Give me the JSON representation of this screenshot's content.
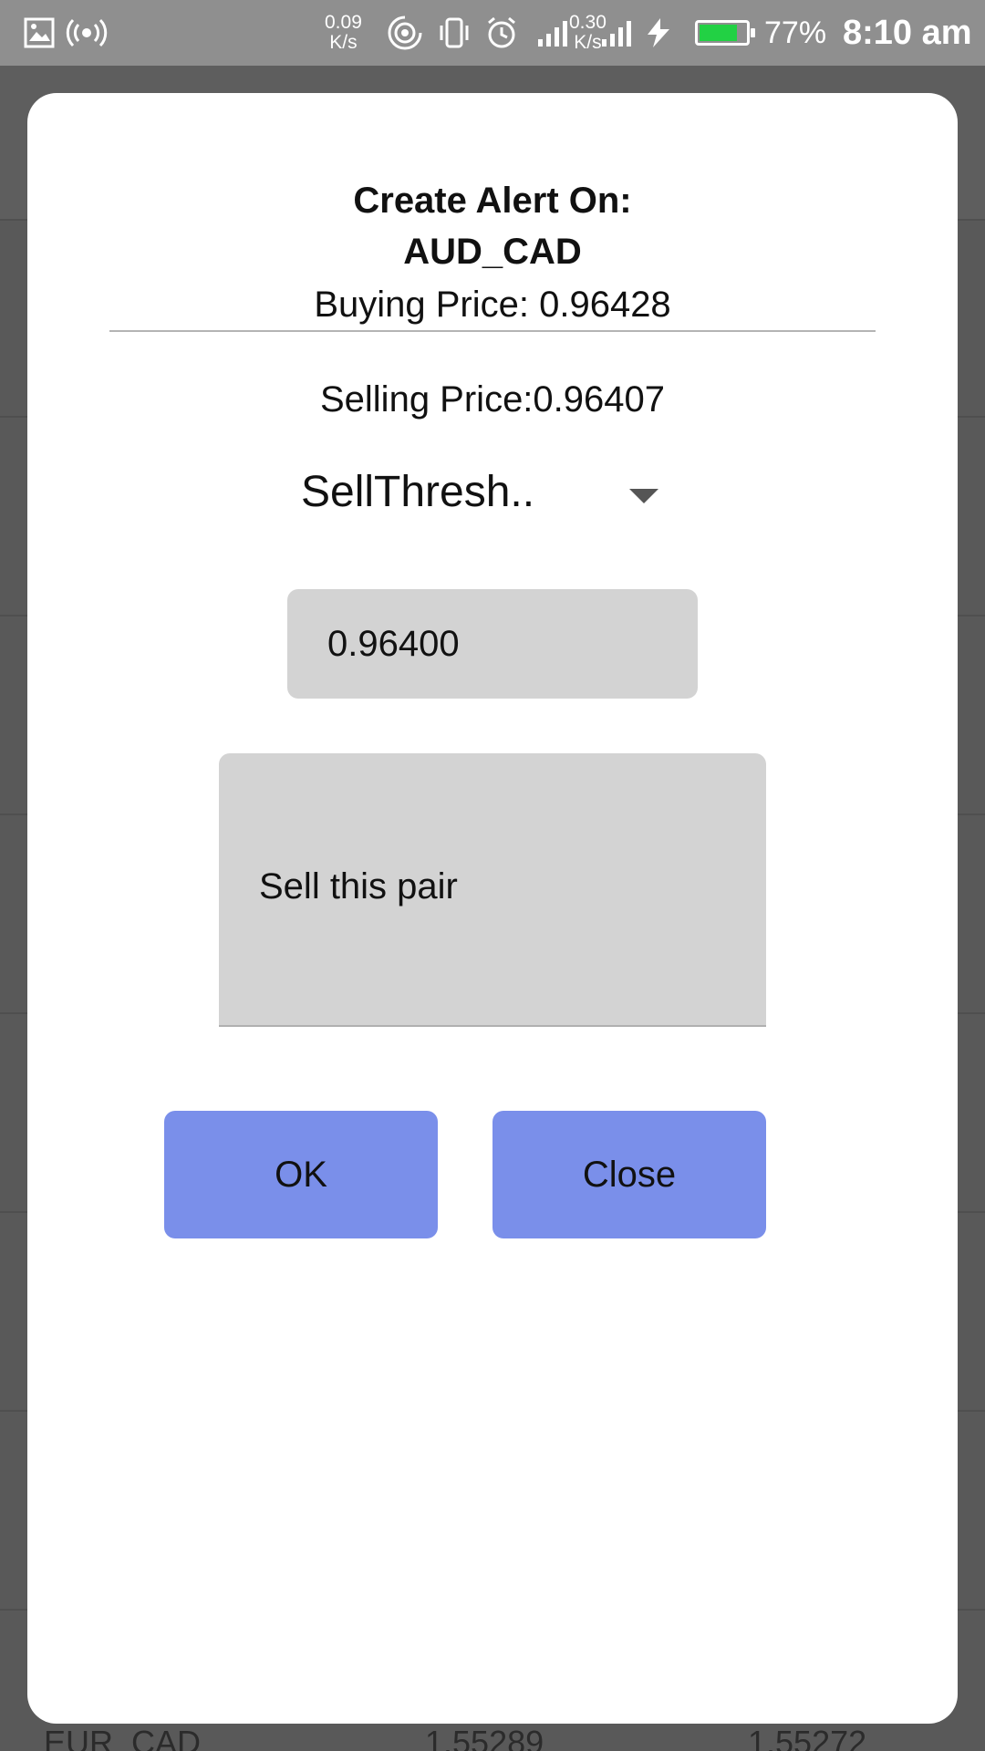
{
  "status_bar": {
    "net_speed_value": "0.09",
    "net_speed_unit": "K/s",
    "net_speed2_value": "0.30",
    "net_speed2_unit": "K/s",
    "battery_percent": "77%",
    "time": "8:10 am",
    "battery_color": "#22d144"
  },
  "background_list": {
    "visible_row": {
      "pair": "EUR_CAD",
      "buy": "1.55289",
      "sell": "1.55272"
    }
  },
  "dialog": {
    "title_line1": "Create Alert On:",
    "title_line2": "AUD_CAD",
    "buying_price": "Buying Price: 0.96428",
    "selling_price": "Selling Price:0.96407",
    "alert_type": {
      "selected": "SellThresh.."
    },
    "threshold_input": {
      "value": "0.96400"
    },
    "message": {
      "value": "Sell this pair"
    },
    "buttons": {
      "ok": "OK",
      "close": "Close"
    },
    "accent_color": "#7a8fea"
  }
}
